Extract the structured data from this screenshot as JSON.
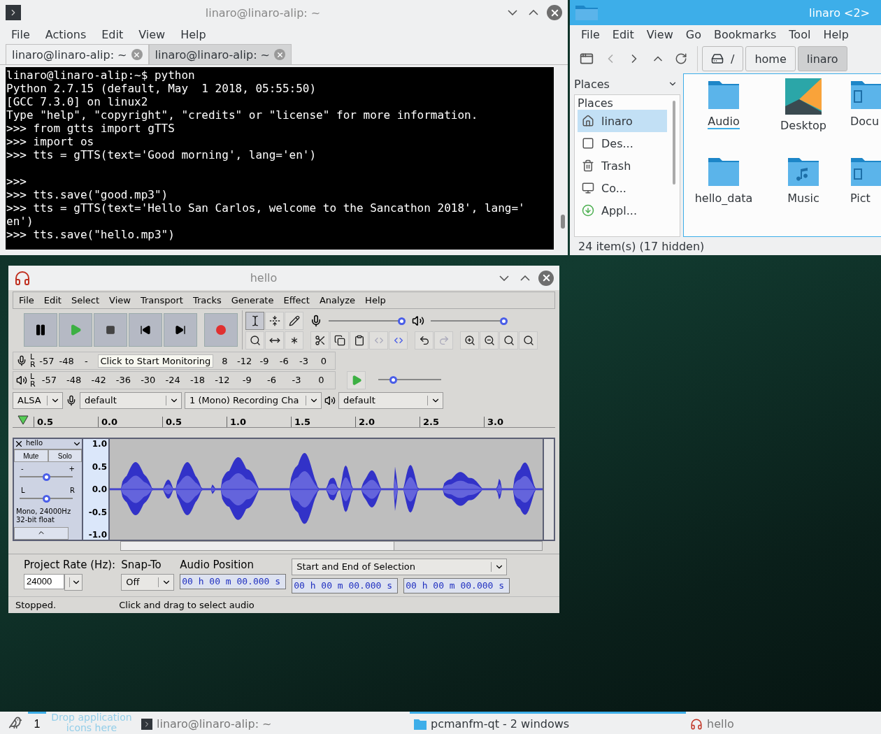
{
  "terminal": {
    "title": "linaro@linaro-alip: ~",
    "menu": [
      "File",
      "Actions",
      "Edit",
      "View",
      "Help"
    ],
    "tabs": [
      {
        "label": "linaro@linaro-alip: ~",
        "selected": true
      },
      {
        "label": "linaro@linaro-alip: ~",
        "selected": false
      }
    ],
    "lines": [
      {
        "kind": "text",
        "text": "linaro@linaro-alip:~$ python"
      },
      {
        "kind": "text",
        "text": "Python 2.7.15 (default, May  1 2018, 05:55:50)"
      },
      {
        "kind": "text",
        "text": "[GCC 7.3.0] on linux2"
      },
      {
        "kind": "text",
        "text": "Type \"help\", \"copyright\", \"credits\" or \"license\" for more information."
      },
      {
        "kind": "text",
        "text": ">>> from gtts import gTTS"
      },
      {
        "kind": "text",
        "text": ">>> import os"
      },
      {
        "kind": "text",
        "text": ">>> tts = gTTS(text='Good morning', lang='en')"
      },
      {
        "kind": "blank"
      },
      {
        "kind": "text",
        "text": ">>>"
      },
      {
        "kind": "text",
        "text": ">>> tts.save(\"good.mp3\")"
      },
      {
        "kind": "text",
        "text": ">>> tts = gTTS(text='Hello San Carlos, welcome to the Sancathon 2018', lang='"
      },
      {
        "kind": "text",
        "text": "en')"
      },
      {
        "kind": "text",
        "text": ">>> tts.save(\"hello.mp3\")"
      }
    ]
  },
  "file_manager": {
    "title": "linaro <2>",
    "menu": [
      "File",
      "Edit",
      "View",
      "Go",
      "Bookmarks",
      "Tool",
      "Help"
    ],
    "path": [
      {
        "label": "/",
        "kind": "root",
        "selected": false
      },
      {
        "label": "home",
        "kind": "dir",
        "selected": false
      },
      {
        "label": "linaro",
        "kind": "dir",
        "selected": true
      }
    ],
    "places_dropdown": "Places",
    "places_heading": "Places",
    "places": [
      {
        "label": "linaro",
        "kind": "home",
        "selected": true
      },
      {
        "label": "Des...",
        "kind": "desktop",
        "selected": false
      },
      {
        "label": "Trash",
        "kind": "trash",
        "selected": false
      },
      {
        "label": "Co...",
        "kind": "computer",
        "selected": false
      },
      {
        "label": "Appl...",
        "kind": "apps",
        "selected": false
      }
    ],
    "files": [
      {
        "name": "Audio",
        "kind": "folder",
        "selected": true
      },
      {
        "name": "Desktop",
        "kind": "desktop",
        "selected": false
      },
      {
        "name": "Docu",
        "kind": "documents",
        "selected": false
      },
      {
        "name": "hello_data",
        "kind": "folder",
        "selected": false
      },
      {
        "name": "Music",
        "kind": "music",
        "selected": false
      },
      {
        "name": "Pict",
        "kind": "pictures",
        "selected": false
      }
    ],
    "status": "24 item(s) (17 hidden)"
  },
  "audacity": {
    "title": "hello",
    "menu": [
      "File",
      "Edit",
      "Select",
      "View",
      "Transport",
      "Tracks",
      "Generate",
      "Effect",
      "Analyze",
      "Help"
    ],
    "record_volume": {
      "level": 1.0
    },
    "playback_volume": {
      "level": 1.0
    },
    "play_speed": {
      "level": 0.2
    },
    "record_meter": {
      "channels": [
        "L",
        "R"
      ],
      "ticks_before": [
        "-57",
        "-48",
        "-"
      ],
      "tooltip": "Click to Start Monitoring",
      "ticks_after": [
        "8",
        "-12",
        "-9",
        "-6",
        "-3",
        "0"
      ]
    },
    "playback_meter": {
      "channels": [
        "L",
        "R"
      ],
      "ticks": [
        "-57",
        "-48",
        "-42",
        "-36",
        "-30",
        "-24",
        "-18",
        "-12",
        "-9",
        "-6",
        "-3",
        "0"
      ]
    },
    "devices": {
      "host": "ALSA",
      "recording_device": "default",
      "channels": "1 (Mono) Recording Cha",
      "playback_device": "default"
    },
    "ruler": [
      "0.5",
      "0.0",
      "0.5",
      "1.0",
      "1.5",
      "2.0",
      "2.5",
      "3.0"
    ],
    "track": {
      "name": "hello",
      "mute": "Mute",
      "solo": "Solo",
      "gain": {
        "level": 0.5
      },
      "pan": {
        "level": 0.5
      },
      "pan_left": "L",
      "pan_right": "R",
      "gain_minus": "-",
      "gain_plus": "+",
      "info": [
        "Mono, 24000Hz",
        "32-bit float"
      ],
      "scale": [
        "1.0",
        "0.5",
        "0.0",
        "-0.5",
        "-1.0"
      ]
    },
    "selection_bar": {
      "rate_label": "Project Rate (Hz):",
      "rate": "24000",
      "snap_label": "Snap-To",
      "snap": "Off",
      "position_label": "Audio Position",
      "position": "00 h 00 m 00.000 s",
      "selection_label": "Start and End of Selection",
      "start": "00 h 00 m 00.000 s",
      "end": "00 h 00 m 00.000 s"
    },
    "status": [
      "Stopped.",
      "Click and drag to select audio"
    ]
  },
  "taskbar": {
    "desktops": [
      {
        "label": "1",
        "selected": true
      }
    ],
    "drop_hint": "Drop application icons here",
    "tasks": [
      {
        "label": "linaro@linaro-alip: ~",
        "kind": "terminal",
        "selected": false
      },
      {
        "label": "pcmanfm-qt - 2 windows",
        "kind": "folder",
        "selected": true
      },
      {
        "label": "hello",
        "kind": "audio",
        "selected": false
      }
    ]
  }
}
